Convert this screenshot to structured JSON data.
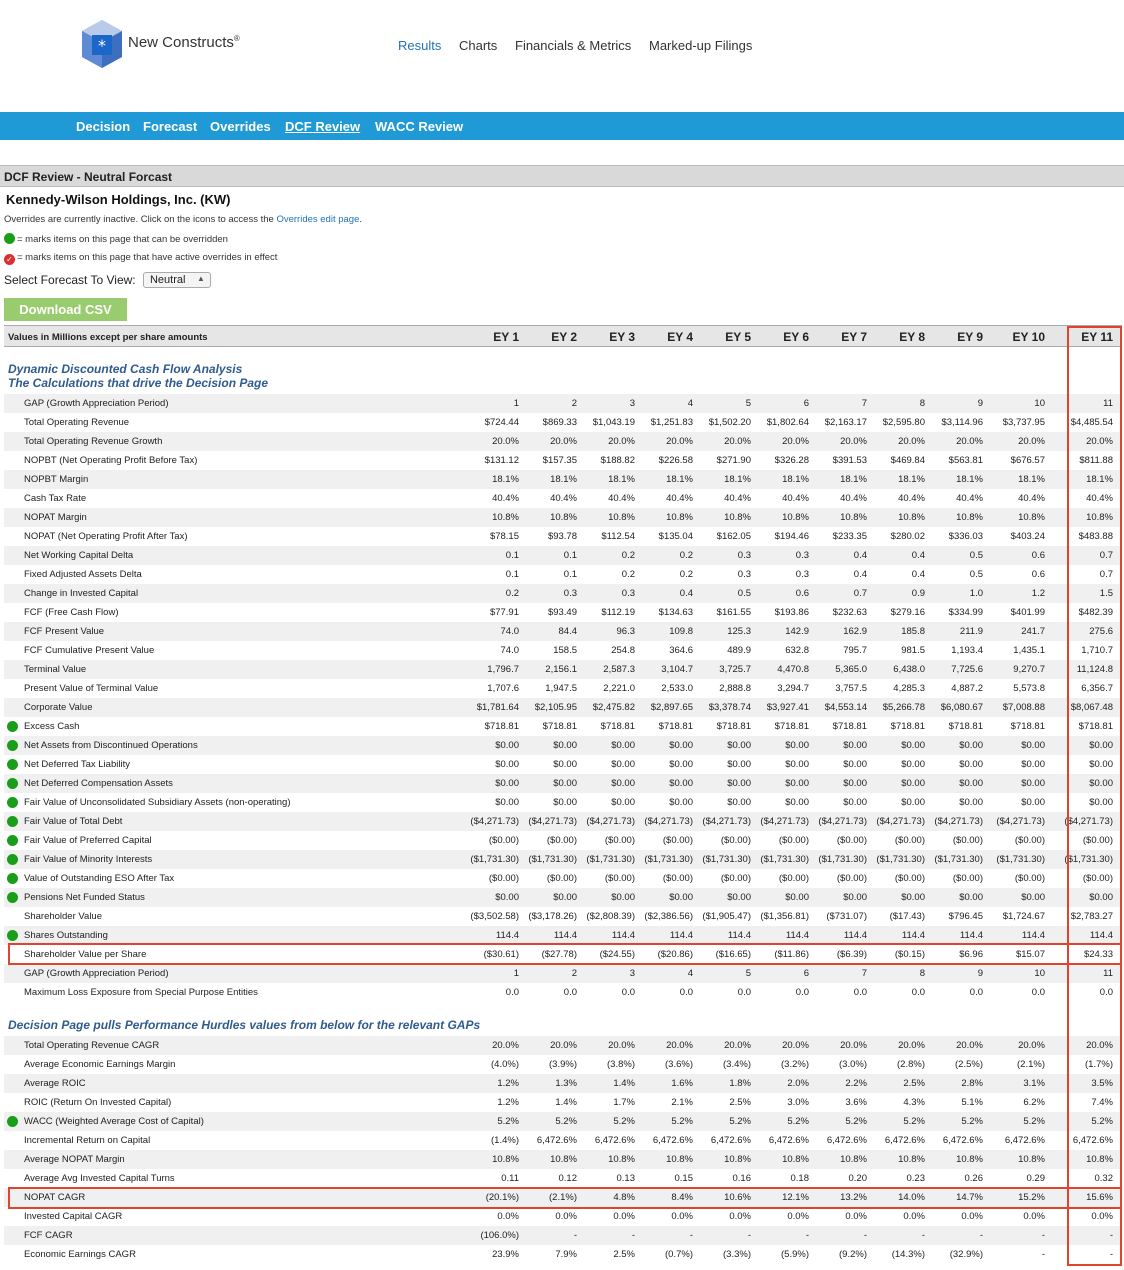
{
  "brand": {
    "name": "New Constructs",
    "mark": "®"
  },
  "top_nav": [
    "Results",
    "Charts",
    "Financials & Metrics",
    "Marked-up Filings"
  ],
  "top_nav_active": 0,
  "sub_nav": [
    "Decision",
    "Forecast",
    "Overrides",
    "DCF Review",
    "WACC Review"
  ],
  "sub_nav_active": 3,
  "section_title": "DCF Review - Neutral Forcast",
  "company": "Kennedy-Wilson Holdings, Inc. (KW)",
  "notes": {
    "overrides_prefix": "Overrides are currently inactive. Click on the icons to access the ",
    "overrides_link": "Overrides edit page",
    "overrides_suffix": ".",
    "green_legend": "= marks items on this page that can be overridden",
    "red_legend": "= marks items on this page that have active overrides in effect"
  },
  "forecast_select": {
    "label": "Select Forecast To View:",
    "value": "Neutral"
  },
  "download_label": "Download CSV",
  "table": {
    "header_label": "Values in Millions except per share amounts",
    "columns": [
      "EY 1",
      "EY 2",
      "EY 3",
      "EY 4",
      "EY 5",
      "EY 6",
      "EY 7",
      "EY 8",
      "EY 9",
      "EY 10",
      "EY 11"
    ],
    "section1_title_1": "Dynamic Discounted Cash Flow Analysis",
    "section1_title_2": "The Calculations that drive the Decision Page",
    "section1_rows": [
      {
        "label": "GAP (Growth Appreciation Period)",
        "dot": false,
        "values": [
          "1",
          "2",
          "3",
          "4",
          "5",
          "6",
          "7",
          "8",
          "9",
          "10",
          "11"
        ]
      },
      {
        "label": "Total Operating Revenue",
        "dot": false,
        "values": [
          "$724.44",
          "$869.33",
          "$1,043.19",
          "$1,251.83",
          "$1,502.20",
          "$1,802.64",
          "$2,163.17",
          "$2,595.80",
          "$3,114.96",
          "$3,737.95",
          "$4,485.54"
        ]
      },
      {
        "label": "Total Operating Revenue Growth",
        "dot": false,
        "values": [
          "20.0%",
          "20.0%",
          "20.0%",
          "20.0%",
          "20.0%",
          "20.0%",
          "20.0%",
          "20.0%",
          "20.0%",
          "20.0%",
          "20.0%"
        ]
      },
      {
        "label": "NOPBT (Net Operating Profit Before Tax)",
        "dot": false,
        "values": [
          "$131.12",
          "$157.35",
          "$188.82",
          "$226.58",
          "$271.90",
          "$326.28",
          "$391.53",
          "$469.84",
          "$563.81",
          "$676.57",
          "$811.88"
        ]
      },
      {
        "label": "NOPBT Margin",
        "dot": false,
        "values": [
          "18.1%",
          "18.1%",
          "18.1%",
          "18.1%",
          "18.1%",
          "18.1%",
          "18.1%",
          "18.1%",
          "18.1%",
          "18.1%",
          "18.1%"
        ]
      },
      {
        "label": "Cash Tax Rate",
        "dot": false,
        "values": [
          "40.4%",
          "40.4%",
          "40.4%",
          "40.4%",
          "40.4%",
          "40.4%",
          "40.4%",
          "40.4%",
          "40.4%",
          "40.4%",
          "40.4%"
        ]
      },
      {
        "label": "NOPAT Margin",
        "dot": false,
        "values": [
          "10.8%",
          "10.8%",
          "10.8%",
          "10.8%",
          "10.8%",
          "10.8%",
          "10.8%",
          "10.8%",
          "10.8%",
          "10.8%",
          "10.8%"
        ]
      },
      {
        "label": "NOPAT (Net Operating Profit After Tax)",
        "dot": false,
        "values": [
          "$78.15",
          "$93.78",
          "$112.54",
          "$135.04",
          "$162.05",
          "$194.46",
          "$233.35",
          "$280.02",
          "$336.03",
          "$403.24",
          "$483.88"
        ]
      },
      {
        "label": "Net Working Capital Delta",
        "dot": false,
        "values": [
          "0.1",
          "0.1",
          "0.2",
          "0.2",
          "0.3",
          "0.3",
          "0.4",
          "0.4",
          "0.5",
          "0.6",
          "0.7"
        ]
      },
      {
        "label": "Fixed Adjusted Assets Delta",
        "dot": false,
        "values": [
          "0.1",
          "0.1",
          "0.2",
          "0.2",
          "0.3",
          "0.3",
          "0.4",
          "0.4",
          "0.5",
          "0.6",
          "0.7"
        ]
      },
      {
        "label": "Change in Invested Capital",
        "dot": false,
        "values": [
          "0.2",
          "0.3",
          "0.3",
          "0.4",
          "0.5",
          "0.6",
          "0.7",
          "0.9",
          "1.0",
          "1.2",
          "1.5"
        ]
      },
      {
        "label": "FCF (Free Cash Flow)",
        "dot": false,
        "values": [
          "$77.91",
          "$93.49",
          "$112.19",
          "$134.63",
          "$161.55",
          "$193.86",
          "$232.63",
          "$279.16",
          "$334.99",
          "$401.99",
          "$482.39"
        ]
      },
      {
        "label": "FCF Present Value",
        "dot": false,
        "values": [
          "74.0",
          "84.4",
          "96.3",
          "109.8",
          "125.3",
          "142.9",
          "162.9",
          "185.8",
          "211.9",
          "241.7",
          "275.6"
        ]
      },
      {
        "label": "FCF Cumulative Present Value",
        "dot": false,
        "values": [
          "74.0",
          "158.5",
          "254.8",
          "364.6",
          "489.9",
          "632.8",
          "795.7",
          "981.5",
          "1,193.4",
          "1,435.1",
          "1,710.7"
        ]
      },
      {
        "label": "Terminal Value",
        "dot": false,
        "values": [
          "1,796.7",
          "2,156.1",
          "2,587.3",
          "3,104.7",
          "3,725.7",
          "4,470.8",
          "5,365.0",
          "6,438.0",
          "7,725.6",
          "9,270.7",
          "11,124.8"
        ]
      },
      {
        "label": "Present Value of Terminal Value",
        "dot": false,
        "values": [
          "1,707.6",
          "1,947.5",
          "2,221.0",
          "2,533.0",
          "2,888.8",
          "3,294.7",
          "3,757.5",
          "4,285.3",
          "4,887.2",
          "5,573.8",
          "6,356.7"
        ]
      },
      {
        "label": "Corporate Value",
        "dot": false,
        "values": [
          "$1,781.64",
          "$2,105.95",
          "$2,475.82",
          "$2,897.65",
          "$3,378.74",
          "$3,927.41",
          "$4,553.14",
          "$5,266.78",
          "$6,080.67",
          "$7,008.88",
          "$8,067.48"
        ]
      },
      {
        "label": "Excess Cash",
        "dot": true,
        "values": [
          "$718.81",
          "$718.81",
          "$718.81",
          "$718.81",
          "$718.81",
          "$718.81",
          "$718.81",
          "$718.81",
          "$718.81",
          "$718.81",
          "$718.81"
        ]
      },
      {
        "label": "Net Assets from Discontinued Operations",
        "dot": true,
        "values": [
          "$0.00",
          "$0.00",
          "$0.00",
          "$0.00",
          "$0.00",
          "$0.00",
          "$0.00",
          "$0.00",
          "$0.00",
          "$0.00",
          "$0.00"
        ]
      },
      {
        "label": "Net Deferred Tax Liability",
        "dot": true,
        "values": [
          "$0.00",
          "$0.00",
          "$0.00",
          "$0.00",
          "$0.00",
          "$0.00",
          "$0.00",
          "$0.00",
          "$0.00",
          "$0.00",
          "$0.00"
        ]
      },
      {
        "label": "Net Deferred Compensation Assets",
        "dot": true,
        "values": [
          "$0.00",
          "$0.00",
          "$0.00",
          "$0.00",
          "$0.00",
          "$0.00",
          "$0.00",
          "$0.00",
          "$0.00",
          "$0.00",
          "$0.00"
        ]
      },
      {
        "label": "Fair Value of Unconsolidated Subsidiary Assets (non-operating)",
        "dot": true,
        "values": [
          "$0.00",
          "$0.00",
          "$0.00",
          "$0.00",
          "$0.00",
          "$0.00",
          "$0.00",
          "$0.00",
          "$0.00",
          "$0.00",
          "$0.00"
        ]
      },
      {
        "label": "Fair Value of Total Debt",
        "dot": true,
        "values": [
          "($4,271.73)",
          "($4,271.73)",
          "($4,271.73)",
          "($4,271.73)",
          "($4,271.73)",
          "($4,271.73)",
          "($4,271.73)",
          "($4,271.73)",
          "($4,271.73)",
          "($4,271.73)",
          "($4,271.73)"
        ]
      },
      {
        "label": "Fair Value of Preferred Capital",
        "dot": true,
        "values": [
          "($0.00)",
          "($0.00)",
          "($0.00)",
          "($0.00)",
          "($0.00)",
          "($0.00)",
          "($0.00)",
          "($0.00)",
          "($0.00)",
          "($0.00)",
          "($0.00)"
        ]
      },
      {
        "label": "Fair Value of Minority Interests",
        "dot": true,
        "values": [
          "($1,731.30)",
          "($1,731.30)",
          "($1,731.30)",
          "($1,731.30)",
          "($1,731.30)",
          "($1,731.30)",
          "($1,731.30)",
          "($1,731.30)",
          "($1,731.30)",
          "($1,731.30)",
          "($1,731.30)"
        ]
      },
      {
        "label": "Value of Outstanding ESO After Tax",
        "dot": true,
        "values": [
          "($0.00)",
          "($0.00)",
          "($0.00)",
          "($0.00)",
          "($0.00)",
          "($0.00)",
          "($0.00)",
          "($0.00)",
          "($0.00)",
          "($0.00)",
          "($0.00)"
        ]
      },
      {
        "label": "Pensions Net Funded Status",
        "dot": true,
        "values": [
          "$0.00",
          "$0.00",
          "$0.00",
          "$0.00",
          "$0.00",
          "$0.00",
          "$0.00",
          "$0.00",
          "$0.00",
          "$0.00",
          "$0.00"
        ]
      },
      {
        "label": "Shareholder Value",
        "dot": false,
        "values": [
          "($3,502.58)",
          "($3,178.26)",
          "($2,808.39)",
          "($2,386.56)",
          "($1,905.47)",
          "($1,356.81)",
          "($731.07)",
          "($17.43)",
          "$796.45",
          "$1,724.67",
          "$2,783.27"
        ]
      },
      {
        "label": "Shares Outstanding",
        "dot": true,
        "values": [
          "114.4",
          "114.4",
          "114.4",
          "114.4",
          "114.4",
          "114.4",
          "114.4",
          "114.4",
          "114.4",
          "114.4",
          "114.4"
        ]
      },
      {
        "label": "Shareholder Value per Share",
        "dot": false,
        "values": [
          "($30.61)",
          "($27.78)",
          "($24.55)",
          "($20.86)",
          "($16.65)",
          "($11.86)",
          "($6.39)",
          "($0.15)",
          "$6.96",
          "$15.07",
          "$24.33"
        ]
      },
      {
        "label": "GAP (Growth Appreciation Period)",
        "dot": false,
        "values": [
          "1",
          "2",
          "3",
          "4",
          "5",
          "6",
          "7",
          "8",
          "9",
          "10",
          "11"
        ]
      },
      {
        "label": "Maximum Loss Exposure from Special Purpose Entities",
        "dot": false,
        "values": [
          "0.0",
          "0.0",
          "0.0",
          "0.0",
          "0.0",
          "0.0",
          "0.0",
          "0.0",
          "0.0",
          "0.0",
          "0.0"
        ]
      }
    ],
    "section2_title": "Decision Page pulls Performance Hurdles values from below for the relevant GAPs",
    "section2_rows": [
      {
        "label": "Total Operating Revenue CAGR",
        "dot": false,
        "values": [
          "20.0%",
          "20.0%",
          "20.0%",
          "20.0%",
          "20.0%",
          "20.0%",
          "20.0%",
          "20.0%",
          "20.0%",
          "20.0%",
          "20.0%"
        ]
      },
      {
        "label": "Average Economic Earnings Margin",
        "dot": false,
        "values": [
          "(4.0%)",
          "(3.9%)",
          "(3.8%)",
          "(3.6%)",
          "(3.4%)",
          "(3.2%)",
          "(3.0%)",
          "(2.8%)",
          "(2.5%)",
          "(2.1%)",
          "(1.7%)"
        ]
      },
      {
        "label": "Average ROIC",
        "dot": false,
        "values": [
          "1.2%",
          "1.3%",
          "1.4%",
          "1.6%",
          "1.8%",
          "2.0%",
          "2.2%",
          "2.5%",
          "2.8%",
          "3.1%",
          "3.5%"
        ]
      },
      {
        "label": "ROIC (Return On Invested Capital)",
        "dot": false,
        "values": [
          "1.2%",
          "1.4%",
          "1.7%",
          "2.1%",
          "2.5%",
          "3.0%",
          "3.6%",
          "4.3%",
          "5.1%",
          "6.2%",
          "7.4%"
        ]
      },
      {
        "label": "WACC (Weighted Average Cost of Capital)",
        "dot": true,
        "values": [
          "5.2%",
          "5.2%",
          "5.2%",
          "5.2%",
          "5.2%",
          "5.2%",
          "5.2%",
          "5.2%",
          "5.2%",
          "5.2%",
          "5.2%"
        ]
      },
      {
        "label": "Incremental Return on Capital",
        "dot": false,
        "values": [
          "(1.4%)",
          "6,472.6%",
          "6,472.6%",
          "6,472.6%",
          "6,472.6%",
          "6,472.6%",
          "6,472.6%",
          "6,472.6%",
          "6,472.6%",
          "6,472.6%",
          "6,472.6%"
        ]
      },
      {
        "label": "Average NOPAT Margin",
        "dot": false,
        "values": [
          "10.8%",
          "10.8%",
          "10.8%",
          "10.8%",
          "10.8%",
          "10.8%",
          "10.8%",
          "10.8%",
          "10.8%",
          "10.8%",
          "10.8%"
        ]
      },
      {
        "label": "Average Avg Invested Capital Turns",
        "dot": false,
        "values": [
          "0.11",
          "0.12",
          "0.13",
          "0.15",
          "0.16",
          "0.18",
          "0.20",
          "0.23",
          "0.26",
          "0.29",
          "0.32"
        ]
      },
      {
        "label": "NOPAT CAGR",
        "dot": false,
        "values": [
          "(20.1%)",
          "(2.1%)",
          "4.8%",
          "8.4%",
          "10.6%",
          "12.1%",
          "13.2%",
          "14.0%",
          "14.7%",
          "15.2%",
          "15.6%"
        ]
      },
      {
        "label": "Invested Capital CAGR",
        "dot": false,
        "values": [
          "0.0%",
          "0.0%",
          "0.0%",
          "0.0%",
          "0.0%",
          "0.0%",
          "0.0%",
          "0.0%",
          "0.0%",
          "0.0%",
          "0.0%"
        ]
      },
      {
        "label": "FCF CAGR",
        "dot": false,
        "values": [
          "(106.0%)",
          "-",
          "-",
          "-",
          "-",
          "-",
          "-",
          "-",
          "-",
          "-",
          "-"
        ]
      },
      {
        "label": "Economic Earnings CAGR",
        "dot": false,
        "values": [
          "23.9%",
          "7.9%",
          "2.5%",
          "(0.7%)",
          "(3.3%)",
          "(5.9%)",
          "(9.2%)",
          "(14.3%)",
          "(32.9%)",
          "-",
          "-"
        ]
      }
    ]
  },
  "colors": {
    "nav_bar": "#1f9ad6",
    "link": "#1f73b7",
    "override_dot": "#1a9e1a",
    "active_override_dot": "#d93030",
    "download_button": "#99cc6e",
    "highlight_box": "#e0442c",
    "section_title": "#2f5b8e"
  }
}
